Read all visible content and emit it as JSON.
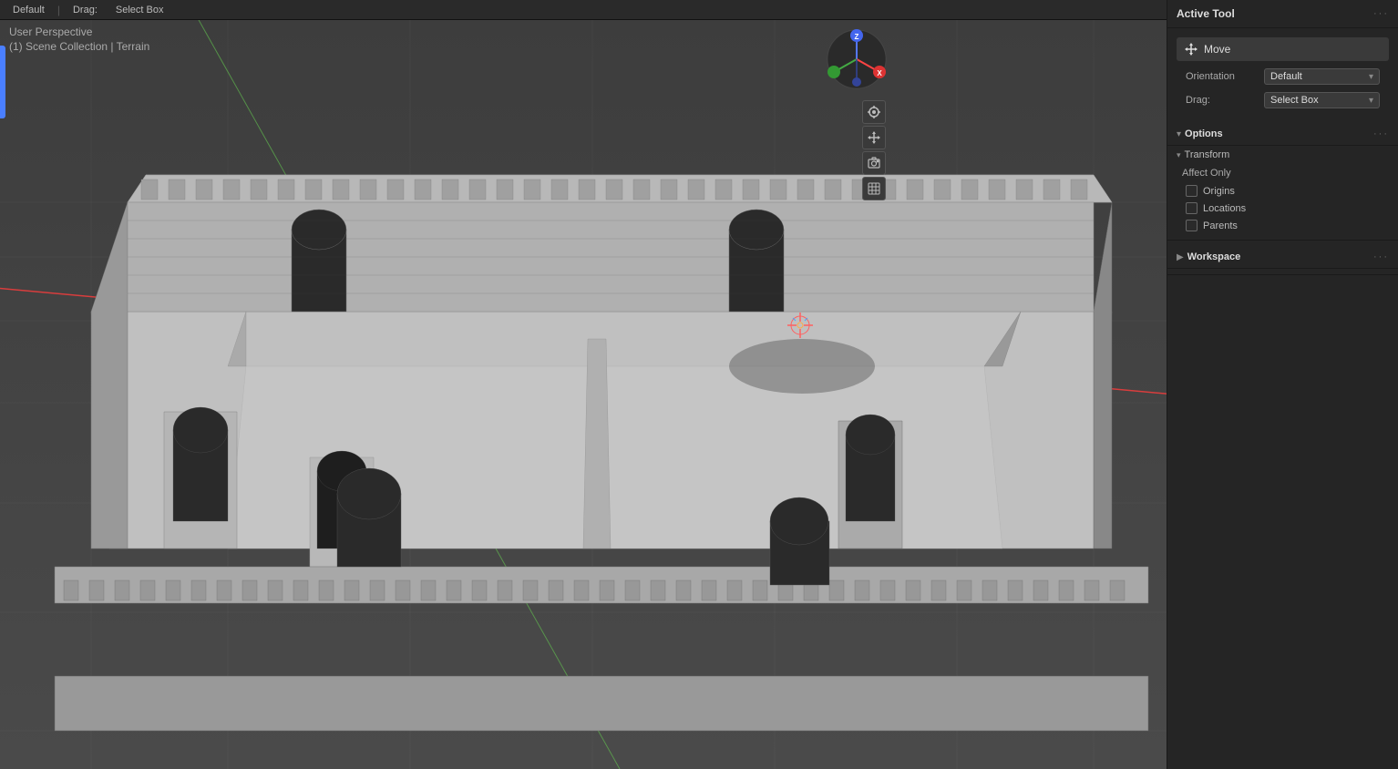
{
  "viewport": {
    "view_label": "User Perspective",
    "collection_label": "(1) Scene Collection | Terrain"
  },
  "topbar": {
    "items": [
      "Default",
      "Drag:",
      "Select Box"
    ]
  },
  "right_panel": {
    "active_tool_title": "Active Tool",
    "dots": "···",
    "move_label": "Move",
    "orientation_label": "Orientation",
    "orientation_value": "Default",
    "drag_label": "Drag:",
    "drag_value": "Select Box",
    "options_title": "Options",
    "transform_title": "Transform",
    "affect_only_label": "Affect Only",
    "origins_label": "Origins",
    "locations_label": "Locations",
    "parents_label": "Parents",
    "workspace_title": "Workspace",
    "options_dots": "···",
    "workspace_dots": "···"
  }
}
